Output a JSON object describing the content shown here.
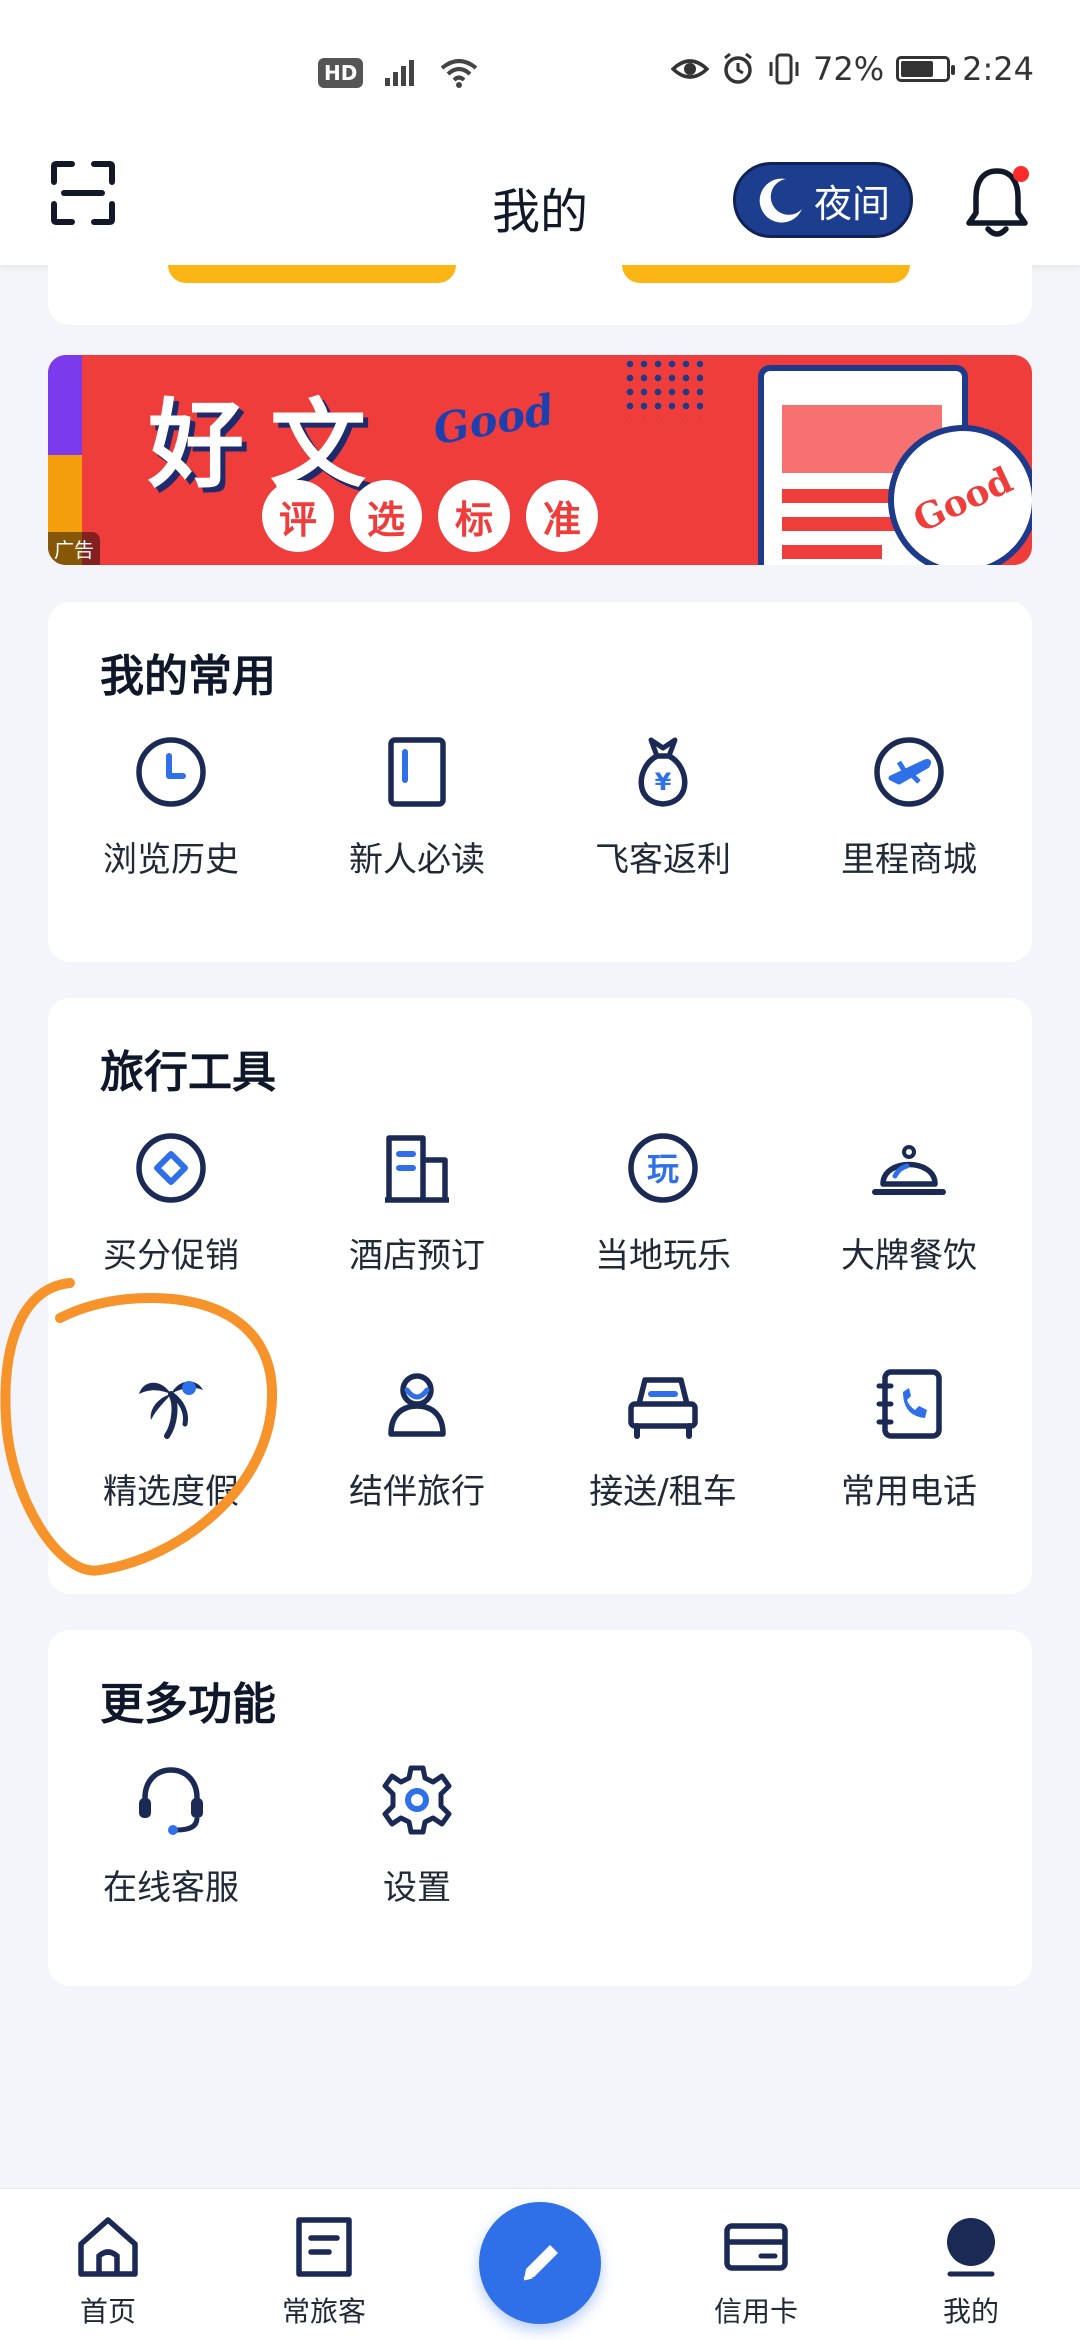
{
  "status_bar": {
    "hd": "HD",
    "battery": "72%",
    "time": "2:24",
    "battery_level": 0.72
  },
  "header": {
    "title": "我的",
    "night_label": "夜间"
  },
  "banner": {
    "title": "好文",
    "good_text": "Good",
    "chips": [
      "评",
      "选",
      "标",
      "准"
    ],
    "stamp_text": "Good",
    "ad_tag": "广告"
  },
  "common": {
    "title": "我的常用",
    "items": [
      {
        "label": "浏览历史",
        "icon": "clock-icon"
      },
      {
        "label": "新人必读",
        "icon": "book-icon"
      },
      {
        "label": "飞客返利",
        "icon": "money-bag-icon"
      },
      {
        "label": "里程商城",
        "icon": "plane-icon"
      }
    ]
  },
  "tools": {
    "title": "旅行工具",
    "items": [
      {
        "label": "买分促销",
        "icon": "diamond-icon"
      },
      {
        "label": "酒店预订",
        "icon": "hotel-icon"
      },
      {
        "label": "当地玩乐",
        "icon": "play-icon",
        "glyph": "玩"
      },
      {
        "label": "大牌餐饮",
        "icon": "cloche-icon"
      },
      {
        "label": "精选度假",
        "icon": "palm-tree-icon"
      },
      {
        "label": "结伴旅行",
        "icon": "companions-icon"
      },
      {
        "label": "接送/租车",
        "icon": "car-icon"
      },
      {
        "label": "常用电话",
        "icon": "phone-book-icon"
      }
    ]
  },
  "more": {
    "title": "更多功能",
    "items": [
      {
        "label": "在线客服",
        "icon": "headset-icon"
      },
      {
        "label": "设置",
        "icon": "gear-icon"
      }
    ]
  },
  "bottom_nav": {
    "items": [
      {
        "label": "首页",
        "icon": "home-icon"
      },
      {
        "label": "常旅客",
        "icon": "frequent-flyer-icon"
      },
      {
        "label": "信用卡",
        "icon": "credit-card-icon"
      },
      {
        "label": "我的",
        "icon": "profile-icon"
      }
    ],
    "fab_icon": "pen-icon"
  },
  "colors": {
    "accent": "#2f6fe8",
    "navy": "#1b2a55",
    "banner_red": "#ef3d3b",
    "highlight": "#f59e0b",
    "annotation": "#f7932b"
  }
}
